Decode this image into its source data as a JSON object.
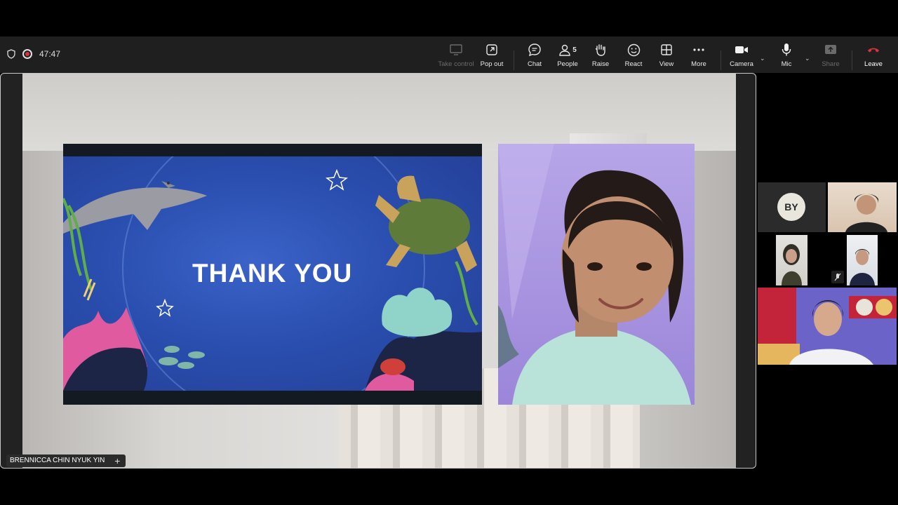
{
  "meeting": {
    "timer": "47:47"
  },
  "toolbar": {
    "take_control": "Take control",
    "pop_out": "Pop out",
    "chat": "Chat",
    "people": "People",
    "people_count": "5",
    "raise": "Raise",
    "react": "React",
    "view": "View",
    "more": "More",
    "camera": "Camera",
    "mic": "Mic",
    "share": "Share",
    "leave": "Leave"
  },
  "slide": {
    "text": "THANK YOU"
  },
  "presenter": {
    "name": "BRENNICCA CHIN NYUK YIN"
  },
  "participants": [
    {
      "initials": "BY"
    }
  ],
  "colors": {
    "leave_red": "#d6333c",
    "toolbar_bg": "#1f1f1f",
    "stage_border": "#c8c8c8"
  }
}
